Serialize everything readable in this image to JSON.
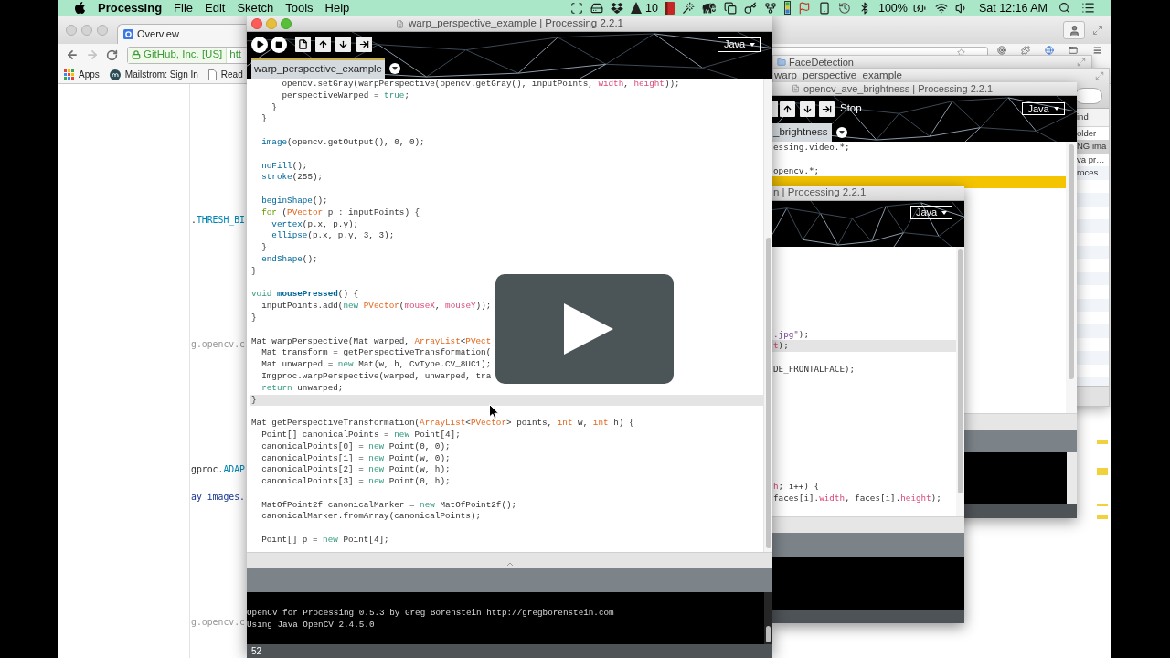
{
  "menu_bar": {
    "app_name": "Processing",
    "menus": [
      "File",
      "Edit",
      "Sketch",
      "Tools",
      "Help"
    ],
    "app_badge": "10",
    "battery_percent": "100%",
    "clock": "Sat 12:16 AM"
  },
  "browser": {
    "tab": {
      "title": "Overview"
    },
    "site_identity": "GitHub, Inc. [US]",
    "url": "htt",
    "bookmarks": [
      {
        "label": "Apps",
        "kind": "apps"
      },
      {
        "label": "Mailstrom: Sign In",
        "kind": "site"
      },
      {
        "label": "Read",
        "kind": "page"
      }
    ],
    "page_lines": [
      {
        "kind": "blank"
      },
      {
        "kind": "blank"
      },
      {
        "kind": "blank"
      },
      {
        "kind": "blank"
      },
      {
        "kind": "blank"
      },
      {
        "kind": "blank"
      },
      {
        "kind": "blank"
      },
      {
        "kind": "blank"
      },
      {
        "kind": "blank"
      },
      {
        "kind": "code",
        "tokens": [
          {
            "text": ".",
            "kind": "plain"
          },
          {
            "text": "THRESH_BI",
            "kind": "constant"
          }
        ]
      },
      {
        "kind": "blank"
      },
      {
        "kind": "blank"
      },
      {
        "kind": "blank"
      },
      {
        "kind": "blank"
      },
      {
        "kind": "blank"
      },
      {
        "kind": "blank"
      },
      {
        "kind": "blank"
      },
      {
        "kind": "blank"
      },
      {
        "kind": "code",
        "tokens": [
          {
            "text": "g.opencv.c",
            "kind": "comment"
          }
        ]
      },
      {
        "kind": "blank"
      },
      {
        "kind": "blank"
      },
      {
        "kind": "blank"
      },
      {
        "kind": "blank"
      },
      {
        "kind": "blank"
      },
      {
        "kind": "blank"
      },
      {
        "kind": "blank"
      },
      {
        "kind": "blank"
      },
      {
        "kind": "code",
        "tokens": [
          {
            "text": "gproc.",
            "kind": "plain"
          },
          {
            "text": "ADAP",
            "kind": "constant"
          }
        ]
      },
      {
        "kind": "blank"
      },
      {
        "kind": "code",
        "tokens": [
          {
            "text": "ay images.",
            "kind": "string"
          }
        ]
      },
      {
        "kind": "blank"
      },
      {
        "kind": "blank"
      },
      {
        "kind": "blank"
      },
      {
        "kind": "blank"
      },
      {
        "kind": "blank"
      },
      {
        "kind": "blank"
      },
      {
        "kind": "blank"
      },
      {
        "kind": "blank"
      },
      {
        "kind": "code",
        "tokens": [
          {
            "text": "g.opencv.c",
            "kind": "comment"
          }
        ]
      }
    ]
  },
  "finder_windows": [
    {
      "title": "FaceDetection"
    },
    {
      "title": "warp_perspective_example",
      "column_header": "ind",
      "rows": [
        {
          "label": "older",
          "selected": false
        },
        {
          "label": "NG ima",
          "selected": true
        },
        {
          "label": "va pr…",
          "selected": false
        },
        {
          "label": "roces…",
          "selected": false
        }
      ]
    }
  ],
  "sketch_windows": [
    {
      "title": "opencv_ave_brightness | Processing 2.2.1",
      "toolbar_hint": "Stop",
      "mode": "Java",
      "tabs": [
        {
          "label": "_brightness",
          "selected": true
        }
      ],
      "lines": [
        {
          "kind": "code",
          "marked": false,
          "tokens": [
            {
              "text": "essing.video.*;",
              "kind": "plain"
            }
          ]
        },
        {
          "kind": "blank",
          "marked": false
        },
        {
          "kind": "code",
          "marked": false,
          "tokens": [
            {
              "text": "opencv.*;",
              "kind": "plain"
            }
          ]
        },
        {
          "kind": "blank",
          "marked": true
        }
      ]
    },
    {
      "title": "n | Processing 2.2.1",
      "mode": "Java",
      "lines": [
        {
          "kind": "blank",
          "current": false
        },
        {
          "kind": "blank",
          "current": false
        },
        {
          "kind": "blank",
          "current": false
        },
        {
          "kind": "blank",
          "current": false
        },
        {
          "kind": "blank",
          "current": false
        },
        {
          "kind": "blank",
          "current": false
        },
        {
          "kind": "blank",
          "current": false
        },
        {
          "kind": "code",
          "current": false,
          "tokens": [
            {
              "text": ".jpg\"",
              "kind": "string"
            },
            {
              "text": ");",
              "kind": "plain"
            }
          ]
        },
        {
          "kind": "code",
          "current": true,
          "tokens": [
            {
              "text": "t",
              "kind": "variable"
            },
            {
              "text": ");",
              "kind": "plain"
            }
          ]
        },
        {
          "kind": "blank",
          "current": false
        },
        {
          "kind": "code",
          "current": false,
          "tokens": [
            {
              "text": "DE_FRONTALFACE);",
              "kind": "plain"
            }
          ]
        },
        {
          "kind": "blank",
          "current": false
        },
        {
          "kind": "blank",
          "current": false
        },
        {
          "kind": "blank",
          "current": false
        },
        {
          "kind": "blank",
          "current": false
        },
        {
          "kind": "blank",
          "current": false
        },
        {
          "kind": "blank",
          "current": false
        },
        {
          "kind": "blank",
          "current": false
        },
        {
          "kind": "blank",
          "current": false
        },
        {
          "kind": "blank",
          "current": false
        },
        {
          "kind": "code",
          "current": false,
          "tokens": [
            {
              "text": "h",
              "kind": "variable"
            },
            {
              "text": "; i++) {",
              "kind": "plain"
            }
          ]
        },
        {
          "kind": "code",
          "current": false,
          "tokens": [
            {
              "text": "faces[i].",
              "kind": "plain"
            },
            {
              "text": "width",
              "kind": "variable"
            },
            {
              "text": ", faces[i].",
              "kind": "plain"
            },
            {
              "text": "height",
              "kind": "variable"
            },
            {
              "text": ");",
              "kind": "plain"
            }
          ]
        }
      ]
    }
  ],
  "editor": {
    "title": "warp_perspective_example | Processing 2.2.1",
    "mode": "Java",
    "tabs": [
      {
        "label": "warp_perspective_example",
        "selected": true
      }
    ],
    "lines": [
      {
        "kind": "code",
        "current": false,
        "tokens": [
          {
            "text": "      opencv.setGray(warpPerspective(opencv.getGray(), inputPoints, ",
            "kind": "plain"
          },
          {
            "text": "width",
            "kind": "variable"
          },
          {
            "text": ", ",
            "kind": "plain"
          },
          {
            "text": "height",
            "kind": "variable"
          },
          {
            "text": "));",
            "kind": "plain"
          }
        ]
      },
      {
        "kind": "code",
        "current": false,
        "tokens": [
          {
            "text": "      perspectiveWarped = ",
            "kind": "plain"
          },
          {
            "text": "true",
            "kind": "keyword"
          },
          {
            "text": ";",
            "kind": "plain"
          }
        ]
      },
      {
        "kind": "code",
        "current": false,
        "tokens": [
          {
            "text": "    }",
            "kind": "plain"
          }
        ]
      },
      {
        "kind": "code",
        "current": false,
        "tokens": [
          {
            "text": "  }",
            "kind": "plain"
          }
        ]
      },
      {
        "kind": "blank",
        "current": false
      },
      {
        "kind": "code",
        "current": false,
        "tokens": [
          {
            "text": "  image",
            "kind": "function"
          },
          {
            "text": "(opencv.getOutput(), 0, 0);",
            "kind": "plain"
          }
        ]
      },
      {
        "kind": "blank",
        "current": false
      },
      {
        "kind": "code",
        "current": false,
        "tokens": [
          {
            "text": "  noFill",
            "kind": "function"
          },
          {
            "text": "();",
            "kind": "plain"
          }
        ]
      },
      {
        "kind": "code",
        "current": false,
        "tokens": [
          {
            "text": "  stroke",
            "kind": "function"
          },
          {
            "text": "(255);",
            "kind": "plain"
          }
        ]
      },
      {
        "kind": "blank",
        "current": false
      },
      {
        "kind": "code",
        "current": false,
        "tokens": [
          {
            "text": "  beginShape",
            "kind": "function"
          },
          {
            "text": "();",
            "kind": "plain"
          }
        ]
      },
      {
        "kind": "code",
        "current": false,
        "tokens": [
          {
            "text": "  for",
            "kind": "control"
          },
          {
            "text": " (",
            "kind": "plain"
          },
          {
            "text": "PVector",
            "kind": "type"
          },
          {
            "text": " p : inputPoints) {",
            "kind": "plain"
          }
        ]
      },
      {
        "kind": "code",
        "current": false,
        "tokens": [
          {
            "text": "    vertex",
            "kind": "function"
          },
          {
            "text": "(p.x, p.y);",
            "kind": "plain"
          }
        ]
      },
      {
        "kind": "code",
        "current": false,
        "tokens": [
          {
            "text": "    ellipse",
            "kind": "function"
          },
          {
            "text": "(p.x, p.y, 3, 3);",
            "kind": "plain"
          }
        ]
      },
      {
        "kind": "code",
        "current": false,
        "tokens": [
          {
            "text": "  }",
            "kind": "plain"
          }
        ]
      },
      {
        "kind": "code",
        "current": false,
        "tokens": [
          {
            "text": "  endShape",
            "kind": "function"
          },
          {
            "text": "();",
            "kind": "plain"
          }
        ]
      },
      {
        "kind": "code",
        "current": false,
        "tokens": [
          {
            "text": "}",
            "kind": "plain"
          }
        ]
      },
      {
        "kind": "blank",
        "current": false
      },
      {
        "kind": "code",
        "current": false,
        "tokens": [
          {
            "text": "void ",
            "kind": "keyword"
          },
          {
            "text": "mousePressed",
            "kind": "function_bold"
          },
          {
            "text": "() {",
            "kind": "plain"
          }
        ]
      },
      {
        "kind": "code",
        "current": false,
        "tokens": [
          {
            "text": "  inputPoints.add(",
            "kind": "plain"
          },
          {
            "text": "new ",
            "kind": "keyword"
          },
          {
            "text": "PVector",
            "kind": "type"
          },
          {
            "text": "(",
            "kind": "plain"
          },
          {
            "text": "mouseX",
            "kind": "variable"
          },
          {
            "text": ", ",
            "kind": "plain"
          },
          {
            "text": "mouseY",
            "kind": "variable"
          },
          {
            "text": "));",
            "kind": "plain"
          }
        ]
      },
      {
        "kind": "code",
        "current": false,
        "tokens": [
          {
            "text": "}",
            "kind": "plain"
          }
        ]
      },
      {
        "kind": "blank",
        "current": false
      },
      {
        "kind": "code",
        "current": false,
        "tokens": [
          {
            "text": "Mat warpPerspective(Mat warped, ",
            "kind": "plain"
          },
          {
            "text": "ArrayList",
            "kind": "type"
          },
          {
            "text": "<",
            "kind": "plain"
          },
          {
            "text": "PVect",
            "kind": "type"
          }
        ]
      },
      {
        "kind": "code",
        "current": false,
        "tokens": [
          {
            "text": "  Mat transform = getPerspectiveTransformation(",
            "kind": "plain"
          }
        ]
      },
      {
        "kind": "code",
        "current": false,
        "tokens": [
          {
            "text": "  Mat unwarped = ",
            "kind": "plain"
          },
          {
            "text": "new",
            "kind": "keyword"
          },
          {
            "text": " Mat(w, h, CvType.CV_8UC1);",
            "kind": "plain"
          }
        ]
      },
      {
        "kind": "code",
        "current": false,
        "tokens": [
          {
            "text": "  Imgproc.warpPerspective(warped, unwarped, tra",
            "kind": "plain"
          }
        ]
      },
      {
        "kind": "code",
        "current": false,
        "tokens": [
          {
            "text": "  return",
            "kind": "keyword"
          },
          {
            "text": " unwarped;",
            "kind": "plain"
          }
        ]
      },
      {
        "kind": "code",
        "current": true,
        "tokens": [
          {
            "text": "}",
            "kind": "plain"
          }
        ]
      },
      {
        "kind": "blank",
        "current": false
      },
      {
        "kind": "code",
        "current": false,
        "tokens": [
          {
            "text": "Mat getPerspectiveTransformation(",
            "kind": "plain"
          },
          {
            "text": "ArrayList",
            "kind": "type"
          },
          {
            "text": "<",
            "kind": "plain"
          },
          {
            "text": "PVector",
            "kind": "type"
          },
          {
            "text": "> points, ",
            "kind": "plain"
          },
          {
            "text": "int",
            "kind": "type"
          },
          {
            "text": " w, ",
            "kind": "plain"
          },
          {
            "text": "int",
            "kind": "type"
          },
          {
            "text": " h) {",
            "kind": "plain"
          }
        ]
      },
      {
        "kind": "code",
        "current": false,
        "tokens": [
          {
            "text": "  Point[] canonicalPoints = ",
            "kind": "plain"
          },
          {
            "text": "new",
            "kind": "keyword"
          },
          {
            "text": " Point[4];",
            "kind": "plain"
          }
        ]
      },
      {
        "kind": "code",
        "current": false,
        "tokens": [
          {
            "text": "  canonicalPoints[0] = ",
            "kind": "plain"
          },
          {
            "text": "new",
            "kind": "keyword"
          },
          {
            "text": " Point(0, 0);",
            "kind": "plain"
          }
        ]
      },
      {
        "kind": "code",
        "current": false,
        "tokens": [
          {
            "text": "  canonicalPoints[1] = ",
            "kind": "plain"
          },
          {
            "text": "new",
            "kind": "keyword"
          },
          {
            "text": " Point(w, 0);",
            "kind": "plain"
          }
        ]
      },
      {
        "kind": "code",
        "current": false,
        "tokens": [
          {
            "text": "  canonicalPoints[2] = ",
            "kind": "plain"
          },
          {
            "text": "new",
            "kind": "keyword"
          },
          {
            "text": " Point(w, h);",
            "kind": "plain"
          }
        ]
      },
      {
        "kind": "code",
        "current": false,
        "tokens": [
          {
            "text": "  canonicalPoints[3] = ",
            "kind": "plain"
          },
          {
            "text": "new",
            "kind": "keyword"
          },
          {
            "text": " Point(0, h);",
            "kind": "plain"
          }
        ]
      },
      {
        "kind": "blank",
        "current": false
      },
      {
        "kind": "code",
        "current": false,
        "tokens": [
          {
            "text": "  MatOfPoint2f canonicalMarker = ",
            "kind": "plain"
          },
          {
            "text": "new",
            "kind": "keyword"
          },
          {
            "text": " MatOfPoint2f();",
            "kind": "plain"
          }
        ]
      },
      {
        "kind": "code",
        "current": false,
        "tokens": [
          {
            "text": "  canonicalMarker.fromArray(canonicalPoints);",
            "kind": "plain"
          }
        ]
      },
      {
        "kind": "blank",
        "current": false
      },
      {
        "kind": "code",
        "current": false,
        "tokens": [
          {
            "text": "  Point[] p = ",
            "kind": "plain"
          },
          {
            "text": "new",
            "kind": "keyword"
          },
          {
            "text": " Point[4];",
            "kind": "plain"
          }
        ]
      }
    ],
    "console": [
      "OpenCV for Processing 0.5.3 by Greg Borenstein http://gregborenstein.com",
      "Using Java OpenCV 2.4.5.0"
    ],
    "line_number": "52"
  }
}
